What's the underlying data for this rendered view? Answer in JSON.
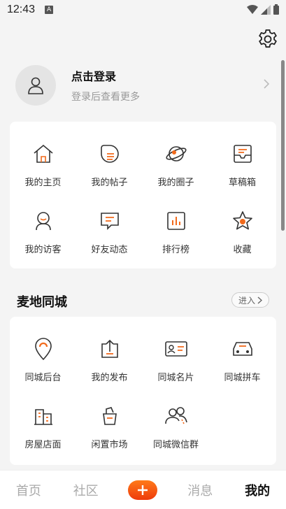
{
  "status_bar": {
    "time": "12:43",
    "sim_label": "A"
  },
  "profile": {
    "title": "点击登录",
    "subtitle": "登录后查看更多"
  },
  "menu_items": [
    {
      "label": "我的主页",
      "icon": "home-icon"
    },
    {
      "label": "我的帖子",
      "icon": "post-icon"
    },
    {
      "label": "我的圈子",
      "icon": "planet-icon"
    },
    {
      "label": "草稿箱",
      "icon": "draft-box-icon"
    },
    {
      "label": "我的访客",
      "icon": "visitor-icon"
    },
    {
      "label": "好友动态",
      "icon": "chat-icon"
    },
    {
      "label": "排行榜",
      "icon": "ranking-icon"
    },
    {
      "label": "收藏",
      "icon": "star-icon"
    }
  ],
  "local_section": {
    "title": "麦地同城",
    "enter_label": "进入",
    "items": [
      {
        "label": "同城后台",
        "icon": "location-pin-icon"
      },
      {
        "label": "我的发布",
        "icon": "publish-icon"
      },
      {
        "label": "同城名片",
        "icon": "business-card-icon"
      },
      {
        "label": "同城拼车",
        "icon": "car-icon"
      },
      {
        "label": "房屋店面",
        "icon": "building-icon"
      },
      {
        "label": "闲置市场",
        "icon": "bag-icon"
      },
      {
        "label": "同城微信群",
        "icon": "group-icon"
      }
    ]
  },
  "tabbar": {
    "tabs": [
      "首页",
      "社区",
      "消息",
      "我的"
    ],
    "active": "我的"
  },
  "colors": {
    "accent": "#f26a1b",
    "background": "#f4f4f4"
  }
}
